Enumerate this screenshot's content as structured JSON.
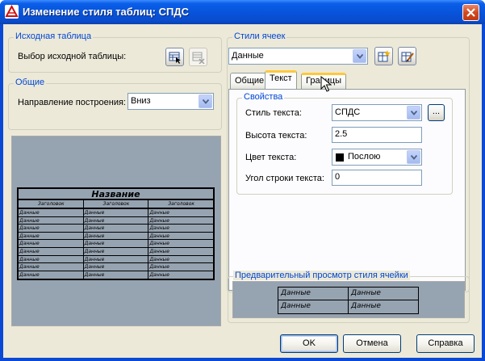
{
  "window": {
    "title": "Изменение стиля таблиц: СПДС"
  },
  "source_table": {
    "group_title": "Исходная таблица",
    "select_label": "Выбор исходной таблицы:"
  },
  "general": {
    "group_title": "Общие",
    "direction_label": "Направление построения:",
    "direction_value": "Вниз"
  },
  "preview_table": {
    "title": "Название",
    "headers": [
      "Заголовок",
      "Заголовок",
      "Заголовок"
    ],
    "row_label": "Данные",
    "row_count": 9
  },
  "cell_styles": {
    "group_title": "Стили ячеек",
    "selected": "Данные",
    "tabs": [
      {
        "label": "Общие"
      },
      {
        "label": "Текст"
      },
      {
        "label": "Границы"
      }
    ],
    "active_tab": "Текст",
    "properties": {
      "group_title": "Свойства",
      "text_style_label": "Стиль текста:",
      "text_style_value": "СПДС",
      "browse_label": "...",
      "text_height_label": "Высота текста:",
      "text_height_value": "2.5",
      "text_color_label": "Цвет текста:",
      "text_color_value": "Послою",
      "text_color_swatch": "#000000",
      "text_angle_label": "Угол строки текста:",
      "text_angle_value": "0"
    }
  },
  "cell_preview": {
    "group_title": "Предварительный просмотр стиля ячейки",
    "cells": [
      [
        "Данные",
        "Данные"
      ],
      [
        "Данные",
        "Данные"
      ]
    ]
  },
  "buttons": {
    "ok": "OK",
    "cancel": "Отмена",
    "help": "Справка"
  },
  "colors": {
    "title_bar": "#0a5ee8",
    "dialog_bg": "#ece9d8",
    "group_title": "#0046d5",
    "preview_bg": "#96a3b1",
    "tab_highlight": "#ffc83c"
  },
  "icons": [
    "app-icon",
    "close-icon",
    "select-table-icon",
    "clear-table-icon",
    "new-cell-style-icon",
    "manage-cell-styles-icon",
    "dropdown-arrow-icon",
    "cursor-icon"
  ]
}
